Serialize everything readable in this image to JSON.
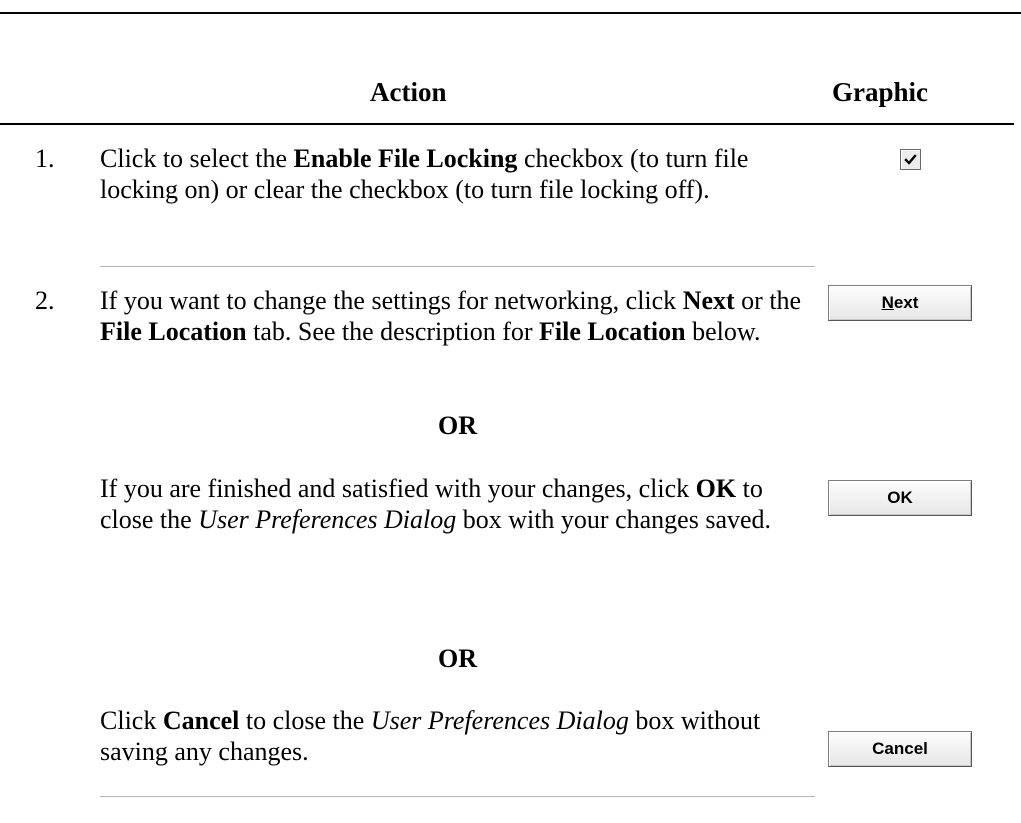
{
  "header": {
    "action": "Action",
    "graphic": "Graphic"
  },
  "steps": [
    {
      "num": "1.",
      "parts": [
        {
          "t": "Click to select the ",
          "s": "normal"
        },
        {
          "t": "Enable File Locking",
          "s": "bold"
        },
        {
          "t": " checkbox (to turn file locking on) or clear the checkbox (to turn file locking off).",
          "s": "normal"
        }
      ]
    },
    {
      "num": "2.",
      "parts": [
        {
          "t": "If you want to change the settings for networking, click ",
          "s": "normal"
        },
        {
          "t": "Next",
          "s": "bold"
        },
        {
          "t": " or the ",
          "s": "normal"
        },
        {
          "t": "File Location",
          "s": "bold"
        },
        {
          "t": " tab.  See the description for ",
          "s": "normal"
        },
        {
          "t": "File Location",
          "s": "bold"
        },
        {
          "t": " below.",
          "s": "normal"
        }
      ]
    }
  ],
  "or_label": "OR",
  "alternatives": [
    {
      "parts": [
        {
          "t": "If you are finished and satisfied with your changes, click ",
          "s": "normal"
        },
        {
          "t": "OK",
          "s": "bold"
        },
        {
          "t": " to close the ",
          "s": "normal"
        },
        {
          "t": "User Preferences Dialog",
          "s": "italic"
        },
        {
          "t": " box with your changes saved.",
          "s": "normal"
        }
      ]
    },
    {
      "parts": [
        {
          "t": "Click ",
          "s": "normal"
        },
        {
          "t": "Cancel",
          "s": "bold"
        },
        {
          "t": " to close the ",
          "s": "normal"
        },
        {
          "t": "User Preferences Dialog",
          "s": "italic"
        },
        {
          "t": " box without saving any changes.",
          "s": "normal"
        }
      ]
    }
  ],
  "graphics": {
    "checkbox_checked": true,
    "next_prefix": "N",
    "next_rest": "ext",
    "ok_label": "OK",
    "cancel_label": "Cancel"
  }
}
